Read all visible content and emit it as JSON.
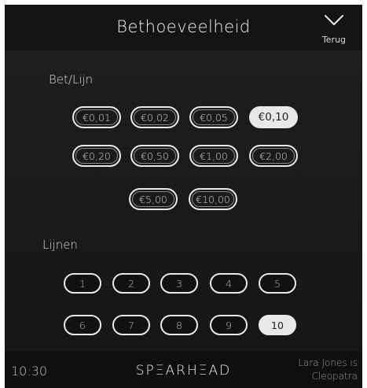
{
  "header": {
    "title": "Bethoeveelheid",
    "back_label": "Terug"
  },
  "bet_per_line": {
    "label": "Bet/Lijn",
    "options": [
      "€0,01",
      "€0,02",
      "€0,05",
      "€0,10",
      "€0,20",
      "€0,50",
      "€1,00",
      "€2,00",
      "€5,00",
      "€10,00"
    ],
    "selected": "€0,10"
  },
  "lines": {
    "label": "Lijnen",
    "options": [
      "1",
      "2",
      "3",
      "4",
      "5",
      "6",
      "7",
      "8",
      "9",
      "10"
    ],
    "selected": "10"
  },
  "footer": {
    "time": "10:30",
    "brand": "SPΞARHΞAD",
    "user_line1": "Lara Jones is",
    "user_line2": "Cleopatra"
  }
}
